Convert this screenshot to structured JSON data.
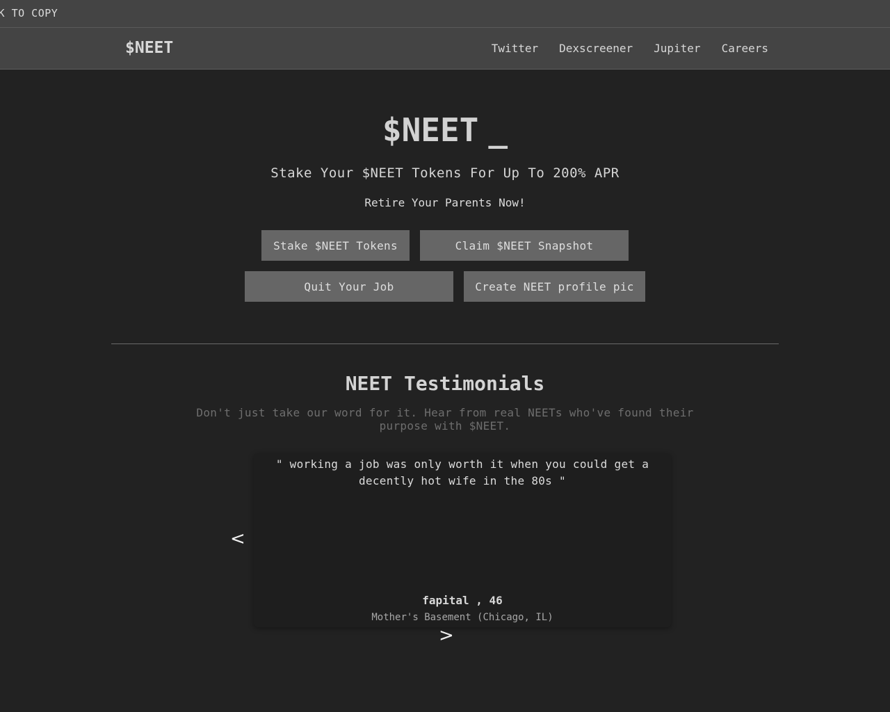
{
  "ticker": {
    "text": "CK TO COPY"
  },
  "navbar": {
    "brand": "$NEET",
    "links": [
      "Twitter",
      "Dexscreener",
      "Jupiter",
      "Careers"
    ]
  },
  "hero": {
    "title": "$NEET",
    "cursor": "_",
    "subtitle": "Stake Your $NEET Tokens For Up To 200% APR",
    "tagline": "Retire Your Parents Now!",
    "buttons": [
      "Stake $NEET Tokens",
      "Claim $NEET Snapshot",
      "Quit Your Job",
      "Create NEET profile pic"
    ]
  },
  "testimonials": {
    "title": "NEET Testimonials",
    "description": "Don't just take our word for it. Hear from real NEETs who've found their purpose with $NEET.",
    "quote": "\" working a job was only worth it when you could get a decently hot wife in the 80s \"",
    "author": "fapital , 46",
    "location": "Mother's Basement (Chicago, IL)",
    "prev_label": "<",
    "next_label": ">"
  }
}
